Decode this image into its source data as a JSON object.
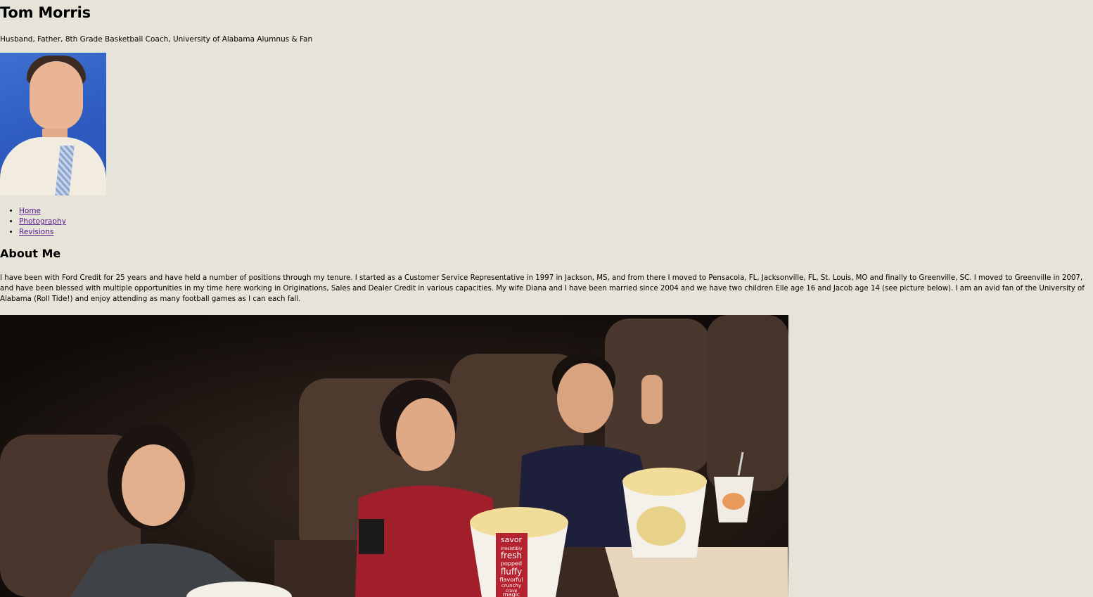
{
  "header": {
    "title": "Tom Morris",
    "tagline": "Husband, Father, 8th Grade Basketball Coach, University of Alabama Alumnus & Fan"
  },
  "nav": {
    "items": [
      {
        "label": "Home"
      },
      {
        "label": "Photography"
      },
      {
        "label": "Revisions"
      }
    ]
  },
  "about": {
    "heading": "About Me",
    "body": "I have been with Ford Credit for 25 years and have held a number of positions through my tenure. I started as a Customer Service Representative in 1997 in Jackson, MS, and from there I moved to Pensacola, FL, Jacksonville, FL, St. Louis, MO and finally to Greenville, SC. I moved to Greenville in 2007, and have been blessed with multiple opportunities in my time here working in Originations, Sales and Dealer Credit in various capacities. My wife Diana and I have been married since 2004 and we have two children Elle age 16 and Jacob age 14 (see picture below). I am an avid fan of the University of Alabama (Roll Tide!) and enjoy attending as many football games as I can each fall."
  },
  "photo": {
    "popcorn_text": [
      "savor",
      "irresistibly",
      "fresh",
      "popped",
      "fluffy",
      "flavorful",
      "crunchy",
      "crave",
      "magic"
    ]
  },
  "colors": {
    "background": "#e6e3d8",
    "link_visited": "#551a8b",
    "portrait_bg": "#2d5bc0"
  }
}
